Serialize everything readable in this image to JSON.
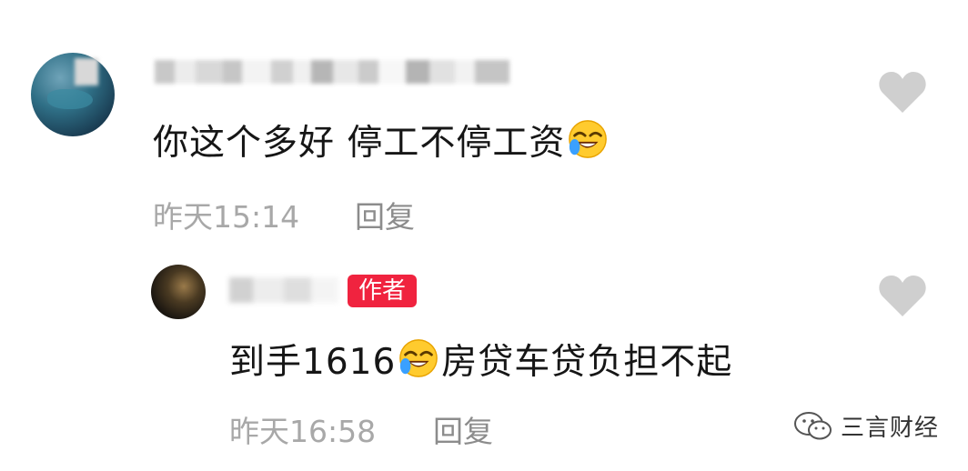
{
  "comments": [
    {
      "text": "你这个多好 停工不停工资",
      "emoji": "crying-laughing-face",
      "time": "昨天15:14",
      "reply": "回复"
    },
    {
      "badge": "作者",
      "text_prefix": "到手1616",
      "emoji": "crying-laughing-face",
      "text_suffix": "房贷车贷负担不起",
      "time": "昨天16:58",
      "reply": "回复"
    }
  ],
  "watermark": "三言财经",
  "colors": {
    "badge": "#f0233f",
    "heart": "#cfcfcf",
    "meta": "#a8a8a8"
  },
  "icons": [
    "heart-icon",
    "wechat-icon",
    "crying-laughing-emoji"
  ]
}
